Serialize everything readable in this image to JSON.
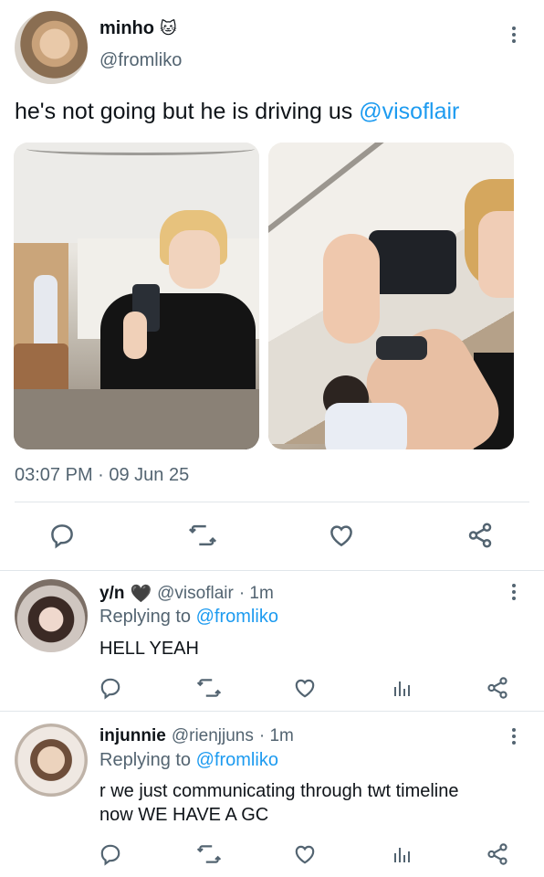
{
  "main_tweet": {
    "display_name": "minho",
    "name_emoji": "🐱",
    "handle": "@fromliko",
    "text": "he's not going but he is driving us ",
    "mention": "@visoflair",
    "timestamp": "03:07 PM · 09 Jun 25",
    "actions": [
      "reply-icon",
      "retweet-icon",
      "like-icon",
      "share-icon"
    ]
  },
  "replies": [
    {
      "display_name": "y/n",
      "name_emoji": "🖤",
      "handle": "@visoflair",
      "time": "· 1m",
      "replying_prefix": "Replying to ",
      "replying_to": "@fromliko",
      "text": "HELL YEAH"
    },
    {
      "display_name": "injunnie",
      "handle": "@rienjjuns",
      "time": "· 1m",
      "replying_prefix": "Replying to ",
      "replying_to": "@fromliko",
      "text_line1": "r we just communicating through twt timeline",
      "text_line2": "now WE HAVE A GC"
    }
  ],
  "colors": {
    "link": "#1d9bf0",
    "secondary_text": "#536471",
    "primary_text": "#0f1419",
    "divider": "#e1e6ea"
  }
}
